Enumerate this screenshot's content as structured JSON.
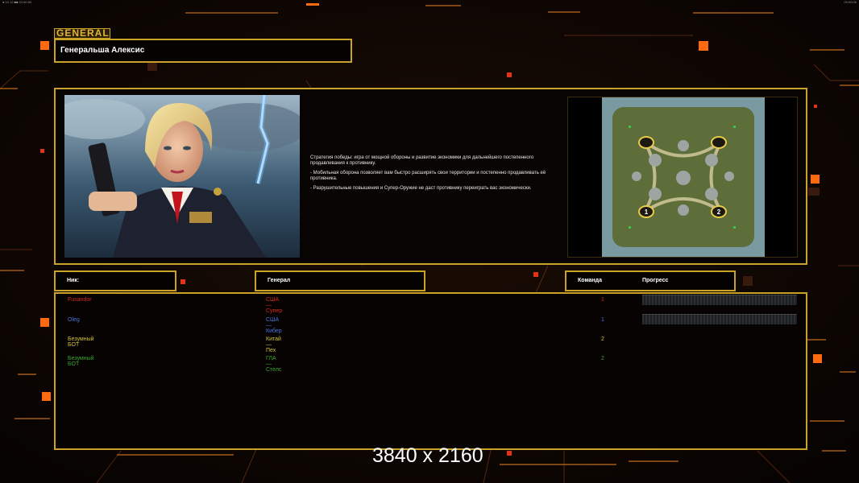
{
  "status_bar": {
    "left_text": "● 10 12 ■■ 21:00:00",
    "right_text": "00:00:00"
  },
  "general": {
    "label": "GENERAL",
    "name": "Генеральша Алексис",
    "description": [
      "Стратегия победы: игра от мощной обороны и развитие экономики для дальнейшего постепенного продавливания к противнику.",
      "- Мобильная оборона позволяет вам быстро расширять свои территории и постепенно продавливать её противника.",
      "- Разрушительные повышения и Супер-Оружие не даст противнику переиграть вас экономически."
    ]
  },
  "map": {
    "start_positions": [
      "1",
      "2"
    ]
  },
  "table": {
    "headers": {
      "nick": "Ник:",
      "general": "Генерал",
      "team": "Команда",
      "progress": "Прогресс"
    },
    "players": [
      {
        "nick": "Fusandor",
        "general": "США — Супер",
        "team": "1",
        "color": "#d42a1e",
        "show_progress": true
      },
      {
        "nick": "Oleg",
        "general": "США — Кибер",
        "team": "1",
        "color": "#4a72e0",
        "show_progress": true
      },
      {
        "nick": "Безумный БОТ",
        "general": "Китай — Пех",
        "team": "2",
        "color": "#d4c23a",
        "show_progress": false
      },
      {
        "nick": "Безумный БОТ",
        "general": "ГЛА — Стелс",
        "team": "2",
        "color": "#3aa62e",
        "show_progress": false
      }
    ]
  },
  "watermark": "3840 x 2160",
  "colors": {
    "accent": "#c9a227",
    "glow": "#ff6a10"
  }
}
